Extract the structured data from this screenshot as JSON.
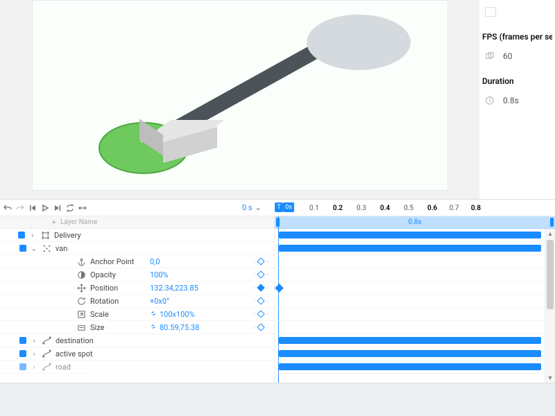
{
  "right_panel": {
    "fps_label": "FPS (frames per second)",
    "fps_value": "60",
    "duration_label": "Duration",
    "duration_value": "0.8s"
  },
  "timeline": {
    "current_time": "0 s",
    "ruler": {
      "playhead_label": "T",
      "end_label": "0s",
      "ticks": [
        {
          "label": "0.1",
          "pos": 11,
          "strong": false
        },
        {
          "label": "0.2",
          "pos": 24,
          "strong": true
        },
        {
          "label": "0.3",
          "pos": 37,
          "strong": false
        },
        {
          "label": "0.4",
          "pos": 50,
          "strong": true
        },
        {
          "label": "0.5",
          "pos": 63,
          "strong": false
        },
        {
          "label": "0.6",
          "pos": 76,
          "strong": true
        },
        {
          "label": "0.7",
          "pos": 88,
          "strong": false
        },
        {
          "label": "0.8",
          "pos": 100,
          "strong": true
        }
      ]
    },
    "duration_bar_label": "0.8s",
    "layer_header_label": "Layer Name",
    "layers": [
      {
        "type": "comp",
        "name": "Delivery",
        "indent": 0,
        "expanded": false,
        "has_vis": true,
        "icon": "hash",
        "buffer": true
      },
      {
        "type": "layer",
        "name": "van",
        "indent": 1,
        "expanded": true,
        "has_vis": true,
        "icon": "group"
      },
      {
        "type": "prop",
        "name": "Anchor Point",
        "value": "0,0",
        "indent": 2,
        "icon": "anchor",
        "kf": "empty"
      },
      {
        "type": "prop",
        "name": "Opacity",
        "value": "100%",
        "indent": 2,
        "icon": "opacity",
        "kf": "empty"
      },
      {
        "type": "prop",
        "name": "Position",
        "value": "132.34,223.85",
        "indent": 2,
        "icon": "position",
        "kf": "filled"
      },
      {
        "type": "prop",
        "name": "Rotation",
        "value": "+0x0°",
        "indent": 2,
        "icon": "rotation",
        "kf": "empty"
      },
      {
        "type": "prop",
        "name": "Scale",
        "value": "100x100%",
        "indent": 2,
        "icon": "scale",
        "kf": "empty",
        "linked": true
      },
      {
        "type": "prop",
        "name": "Size",
        "value": "80.59,75.38",
        "indent": 2,
        "icon": "size",
        "kf": "empty",
        "linked": true
      },
      {
        "type": "layer",
        "name": "destination",
        "indent": 1,
        "expanded": false,
        "has_vis": true,
        "icon": "path"
      },
      {
        "type": "layer",
        "name": "active spot",
        "indent": 1,
        "expanded": false,
        "has_vis": true,
        "icon": "path"
      },
      {
        "type": "layer",
        "name": "road",
        "indent": 1,
        "expanded": false,
        "has_vis": true,
        "icon": "path",
        "cutoff": true
      }
    ],
    "tracks": [
      {
        "kind": "bar"
      },
      {
        "kind": "bar"
      },
      {
        "kind": "empty"
      },
      {
        "kind": "empty"
      },
      {
        "kind": "kf",
        "pos": 0
      },
      {
        "kind": "empty"
      },
      {
        "kind": "empty"
      },
      {
        "kind": "empty"
      },
      {
        "kind": "bar"
      },
      {
        "kind": "bar"
      },
      {
        "kind": "bar"
      }
    ]
  }
}
